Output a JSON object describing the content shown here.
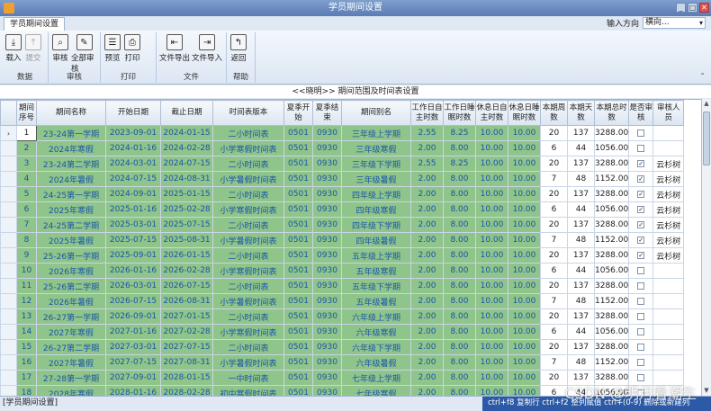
{
  "window": {
    "title": "学员期间设置"
  },
  "tab": {
    "label": "学员期间设置"
  },
  "input_direction": {
    "label": "输入方向",
    "value": "横向..."
  },
  "ribbon": {
    "groups": [
      {
        "name": "数据",
        "buttons": [
          {
            "label": "载入",
            "icon": "download-icon",
            "glyph": "⤓",
            "disabled": false
          },
          {
            "label": "提交",
            "icon": "upload-icon",
            "glyph": "⤒",
            "disabled": true
          }
        ]
      },
      {
        "name": "审核",
        "buttons": [
          {
            "label": "审核",
            "icon": "search-icon",
            "glyph": "⌕",
            "disabled": false
          },
          {
            "label": "全部审核",
            "icon": "check-all-icon",
            "glyph": "✎",
            "disabled": false
          }
        ]
      },
      {
        "name": "打印",
        "buttons": [
          {
            "label": "预览",
            "icon": "preview-icon",
            "glyph": "☰",
            "disabled": false
          },
          {
            "label": "打印",
            "icon": "printer-icon",
            "glyph": "⎙",
            "disabled": false
          }
        ]
      },
      {
        "name": "文件",
        "buttons": [
          {
            "label": "文件导出",
            "icon": "export-icon",
            "glyph": "⇤",
            "disabled": false
          },
          {
            "label": "文件导入",
            "icon": "import-icon",
            "glyph": "⇥",
            "disabled": false
          }
        ]
      },
      {
        "name": "帮助",
        "buttons": [
          {
            "label": "返回",
            "icon": "return-icon",
            "glyph": "↰",
            "disabled": false
          }
        ]
      }
    ]
  },
  "subheader": "<<晓明>>  期间范围及时间表设置",
  "grid": {
    "columns": [
      "期间\n序号",
      "期间名称",
      "开始日期",
      "截止日期",
      "时间表版本",
      "夏季开\n始",
      "夏季结\n束",
      "期间别名",
      "工作日自\n主时数",
      "工作日睡\n眠时数",
      "休息日自\n主时数",
      "休息日睡\n眠时数",
      "本期周\n数",
      "本期天\n数",
      "本期总时\n数",
      "是否审\n核",
      "审核人员"
    ],
    "rows": [
      [
        "1",
        "23-24第一学期",
        "2023-09-01",
        "2024-01-15",
        "二小时间表",
        "0501",
        "0930",
        "三年级上学期",
        "2.55",
        "8.25",
        "10.00",
        "10.00",
        "20",
        "137",
        "3288.00",
        false,
        ""
      ],
      [
        "2",
        "2024年寒假",
        "2024-01-16",
        "2024-02-28",
        "小学寒假时间表",
        "0501",
        "0930",
        "三年级寒假",
        "2.00",
        "8.00",
        "10.00",
        "10.00",
        "6",
        "44",
        "1056.00",
        false,
        ""
      ],
      [
        "3",
        "23-24第二学期",
        "2024-03-01",
        "2024-07-15",
        "二小时间表",
        "0501",
        "0930",
        "三年级下学期",
        "2.55",
        "8.25",
        "10.00",
        "10.00",
        "20",
        "137",
        "3288.00",
        true,
        "云杉树"
      ],
      [
        "4",
        "2024年暑假",
        "2024-07-15",
        "2024-08-31",
        "小学暑假时间表",
        "0501",
        "0930",
        "三年级暑假",
        "2.00",
        "8.00",
        "10.00",
        "10.00",
        "7",
        "48",
        "1152.00",
        true,
        "云杉树"
      ],
      [
        "5",
        "24-25第一学期",
        "2024-09-01",
        "2025-01-15",
        "二小时间表",
        "0501",
        "0930",
        "四年级上学期",
        "2.00",
        "8.00",
        "10.00",
        "10.00",
        "20",
        "137",
        "3288.00",
        true,
        "云杉树"
      ],
      [
        "6",
        "2025年寒假",
        "2025-01-16",
        "2025-02-28",
        "小学寒假时间表",
        "0501",
        "0930",
        "四年级寒假",
        "2.00",
        "8.00",
        "10.00",
        "10.00",
        "6",
        "44",
        "1056.00",
        true,
        "云杉树"
      ],
      [
        "7",
        "24-25第二学期",
        "2025-03-01",
        "2025-07-15",
        "二小时间表",
        "0501",
        "0930",
        "四年级下学期",
        "2.00",
        "8.00",
        "10.00",
        "10.00",
        "20",
        "137",
        "3288.00",
        true,
        "云杉树"
      ],
      [
        "8",
        "2025年暑假",
        "2025-07-15",
        "2025-08-31",
        "小学暑假时间表",
        "0501",
        "0930",
        "四年级暑假",
        "2.00",
        "8.00",
        "10.00",
        "10.00",
        "7",
        "48",
        "1152.00",
        true,
        "云杉树"
      ],
      [
        "9",
        "25-26第一学期",
        "2025-09-01",
        "2026-01-15",
        "二小时间表",
        "0501",
        "0930",
        "五年级上学期",
        "2.00",
        "8.00",
        "10.00",
        "10.00",
        "20",
        "137",
        "3288.00",
        true,
        "云杉树"
      ],
      [
        "10",
        "2026年寒假",
        "2026-01-16",
        "2026-02-28",
        "小学寒假时间表",
        "0501",
        "0930",
        "五年级寒假",
        "2.00",
        "8.00",
        "10.00",
        "10.00",
        "6",
        "44",
        "1056.00",
        false,
        ""
      ],
      [
        "11",
        "25-26第二学期",
        "2026-03-01",
        "2026-07-15",
        "二小时间表",
        "0501",
        "0930",
        "五年级下学期",
        "2.00",
        "8.00",
        "10.00",
        "10.00",
        "20",
        "137",
        "3288.00",
        false,
        ""
      ],
      [
        "12",
        "2026年暑假",
        "2026-07-15",
        "2026-08-31",
        "小学暑假时间表",
        "0501",
        "0930",
        "五年级暑假",
        "2.00",
        "8.00",
        "10.00",
        "10.00",
        "7",
        "48",
        "1152.00",
        false,
        ""
      ],
      [
        "13",
        "26-27第一学期",
        "2026-09-01",
        "2027-01-15",
        "二小时间表",
        "0501",
        "0930",
        "六年级上学期",
        "2.00",
        "8.00",
        "10.00",
        "10.00",
        "20",
        "137",
        "3288.00",
        false,
        ""
      ],
      [
        "14",
        "2027年寒假",
        "2027-01-16",
        "2027-02-28",
        "小学寒假时间表",
        "0501",
        "0930",
        "六年级寒假",
        "2.00",
        "8.00",
        "10.00",
        "10.00",
        "6",
        "44",
        "1056.00",
        false,
        ""
      ],
      [
        "15",
        "26-27第二学期",
        "2027-03-01",
        "2027-07-15",
        "二小时间表",
        "0501",
        "0930",
        "六年级下学期",
        "2.00",
        "8.00",
        "10.00",
        "10.00",
        "20",
        "137",
        "3288.00",
        false,
        ""
      ],
      [
        "16",
        "2027年暑假",
        "2027-07-15",
        "2027-08-31",
        "小学暑假时间表",
        "0501",
        "0930",
        "六年级暑假",
        "2.00",
        "8.00",
        "10.00",
        "10.00",
        "7",
        "48",
        "1152.00",
        false,
        ""
      ],
      [
        "17",
        "27-28第一学期",
        "2027-09-01",
        "2028-01-15",
        "一中时间表",
        "0501",
        "0930",
        "七年级上学期",
        "2.00",
        "8.00",
        "10.00",
        "10.00",
        "20",
        "137",
        "3288.00",
        false,
        ""
      ],
      [
        "18",
        "2028年寒假",
        "2028-01-16",
        "2028-02-28",
        "初中寒假时间表",
        "0501",
        "0930",
        "七年级寒假",
        "2.00",
        "8.00",
        "10.00",
        "10.00",
        "6",
        "44",
        "1056.00",
        false,
        ""
      ]
    ]
  },
  "statusbar": {
    "left": "[学员期间设置]",
    "hint": "ctrl+f8 复制行 ctrl+f2 整列赋值 ctrl+(0-9) 删除或新建列"
  },
  "watermark": "CSDN @明月看潮生"
}
